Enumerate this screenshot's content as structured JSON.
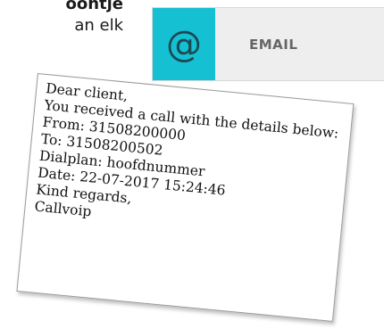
{
  "background": {
    "text_line_1": "oontje",
    "text_line_2": "an elk"
  },
  "email_tile": {
    "icon": "at-sign-icon",
    "icon_glyph": "@",
    "label": "EMAIL",
    "colors": {
      "icon_bg": "#16c0d3",
      "tile_bg": "#eeeeee"
    }
  },
  "email_message": {
    "greeting": "Dear client,",
    "intro": "You received a call with the details below:",
    "from": "From: 31508200000",
    "to": "To: 31508200502",
    "dialplan": "Dialplan: hoofdnummer",
    "date": "Date: 22-07-2017 15:24:46",
    "closing": "Kind regards,",
    "signature": "Callvoip"
  }
}
